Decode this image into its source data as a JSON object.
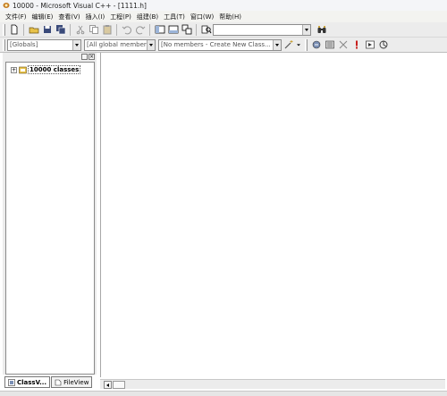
{
  "window": {
    "title": "10000 - Microsoft Visual C++ - [1111.h]"
  },
  "menu": [
    "文件(F)",
    "编辑(E)",
    "查看(V)",
    "插入(I)",
    "工程(P)",
    "组建(B)",
    "工具(T)",
    "窗口(W)",
    "帮助(H)"
  ],
  "wizardbar": {
    "scope": "[Globals]",
    "filter": "[All global members",
    "members": "[No members - Create New Class..."
  },
  "workspace": {
    "tree_root": "10000 classes",
    "tabs": [
      "ClassV...",
      "FileView"
    ]
  },
  "icons": {
    "toolbar1": [
      "new-file",
      "open",
      "save",
      "save-all",
      "cut",
      "copy",
      "paste",
      "undo",
      "redo",
      "workspace",
      "output",
      "window-list",
      "find-in-files",
      "find"
    ],
    "toolbar2": [
      "wand",
      "compile",
      "build",
      "stop-build",
      "execute",
      "go",
      "insert-remove-breakpoint"
    ]
  },
  "colors": {
    "toolbar": "#ececec",
    "editor": "#ffffff",
    "border": "#8a8a8a"
  }
}
